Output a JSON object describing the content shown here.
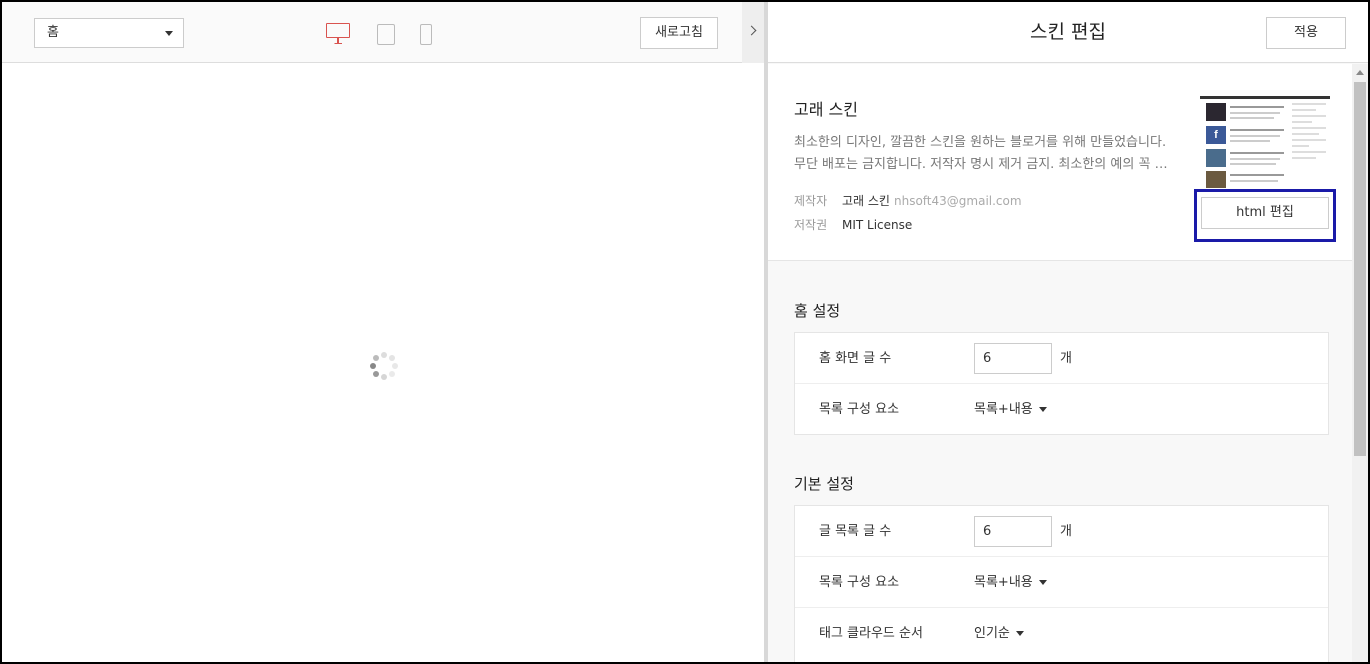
{
  "preview_toolbar": {
    "page_select": "홈",
    "refresh_label": "새로고침",
    "devices": [
      "desktop-icon",
      "tablet-icon",
      "mobile-icon"
    ],
    "active_device_color": "#d9534f"
  },
  "editor": {
    "title": "스킨 편집",
    "apply_label": "적용",
    "skin": {
      "name": "고래 스킨",
      "description_line1": "최소한의 디자인, 깔끔한 스킨을 원하는 블로거를 위해 만들었습니다.",
      "description_line2": "무단 배포는 금지합니다. 저작자 명시 제거 금지. 최소한의 예의 꼭 부탁 드립니다.",
      "author_label": "제작자",
      "author_name": "고래 스킨",
      "author_email": "nhsoft43@gmail.com",
      "license_label": "저작권",
      "license_value": "MIT License",
      "html_edit_label": "html 편집",
      "highlight_color": "#1a1aa8"
    },
    "home_settings": {
      "title": "홈 설정",
      "post_count_label": "홈 화면 글 수",
      "post_count_value": "6",
      "post_count_unit": "개",
      "list_element_label": "목록 구성 요소",
      "list_element_value": "목록+내용"
    },
    "basic_settings": {
      "title": "기본 설정",
      "list_count_label": "글 목록 글 수",
      "list_count_value": "6",
      "list_count_unit": "개",
      "list_element_label": "목록 구성 요소",
      "list_element_value": "목록+내용",
      "tag_order_label": "태그 클라우드 순서",
      "tag_order_value": "인기순"
    }
  }
}
